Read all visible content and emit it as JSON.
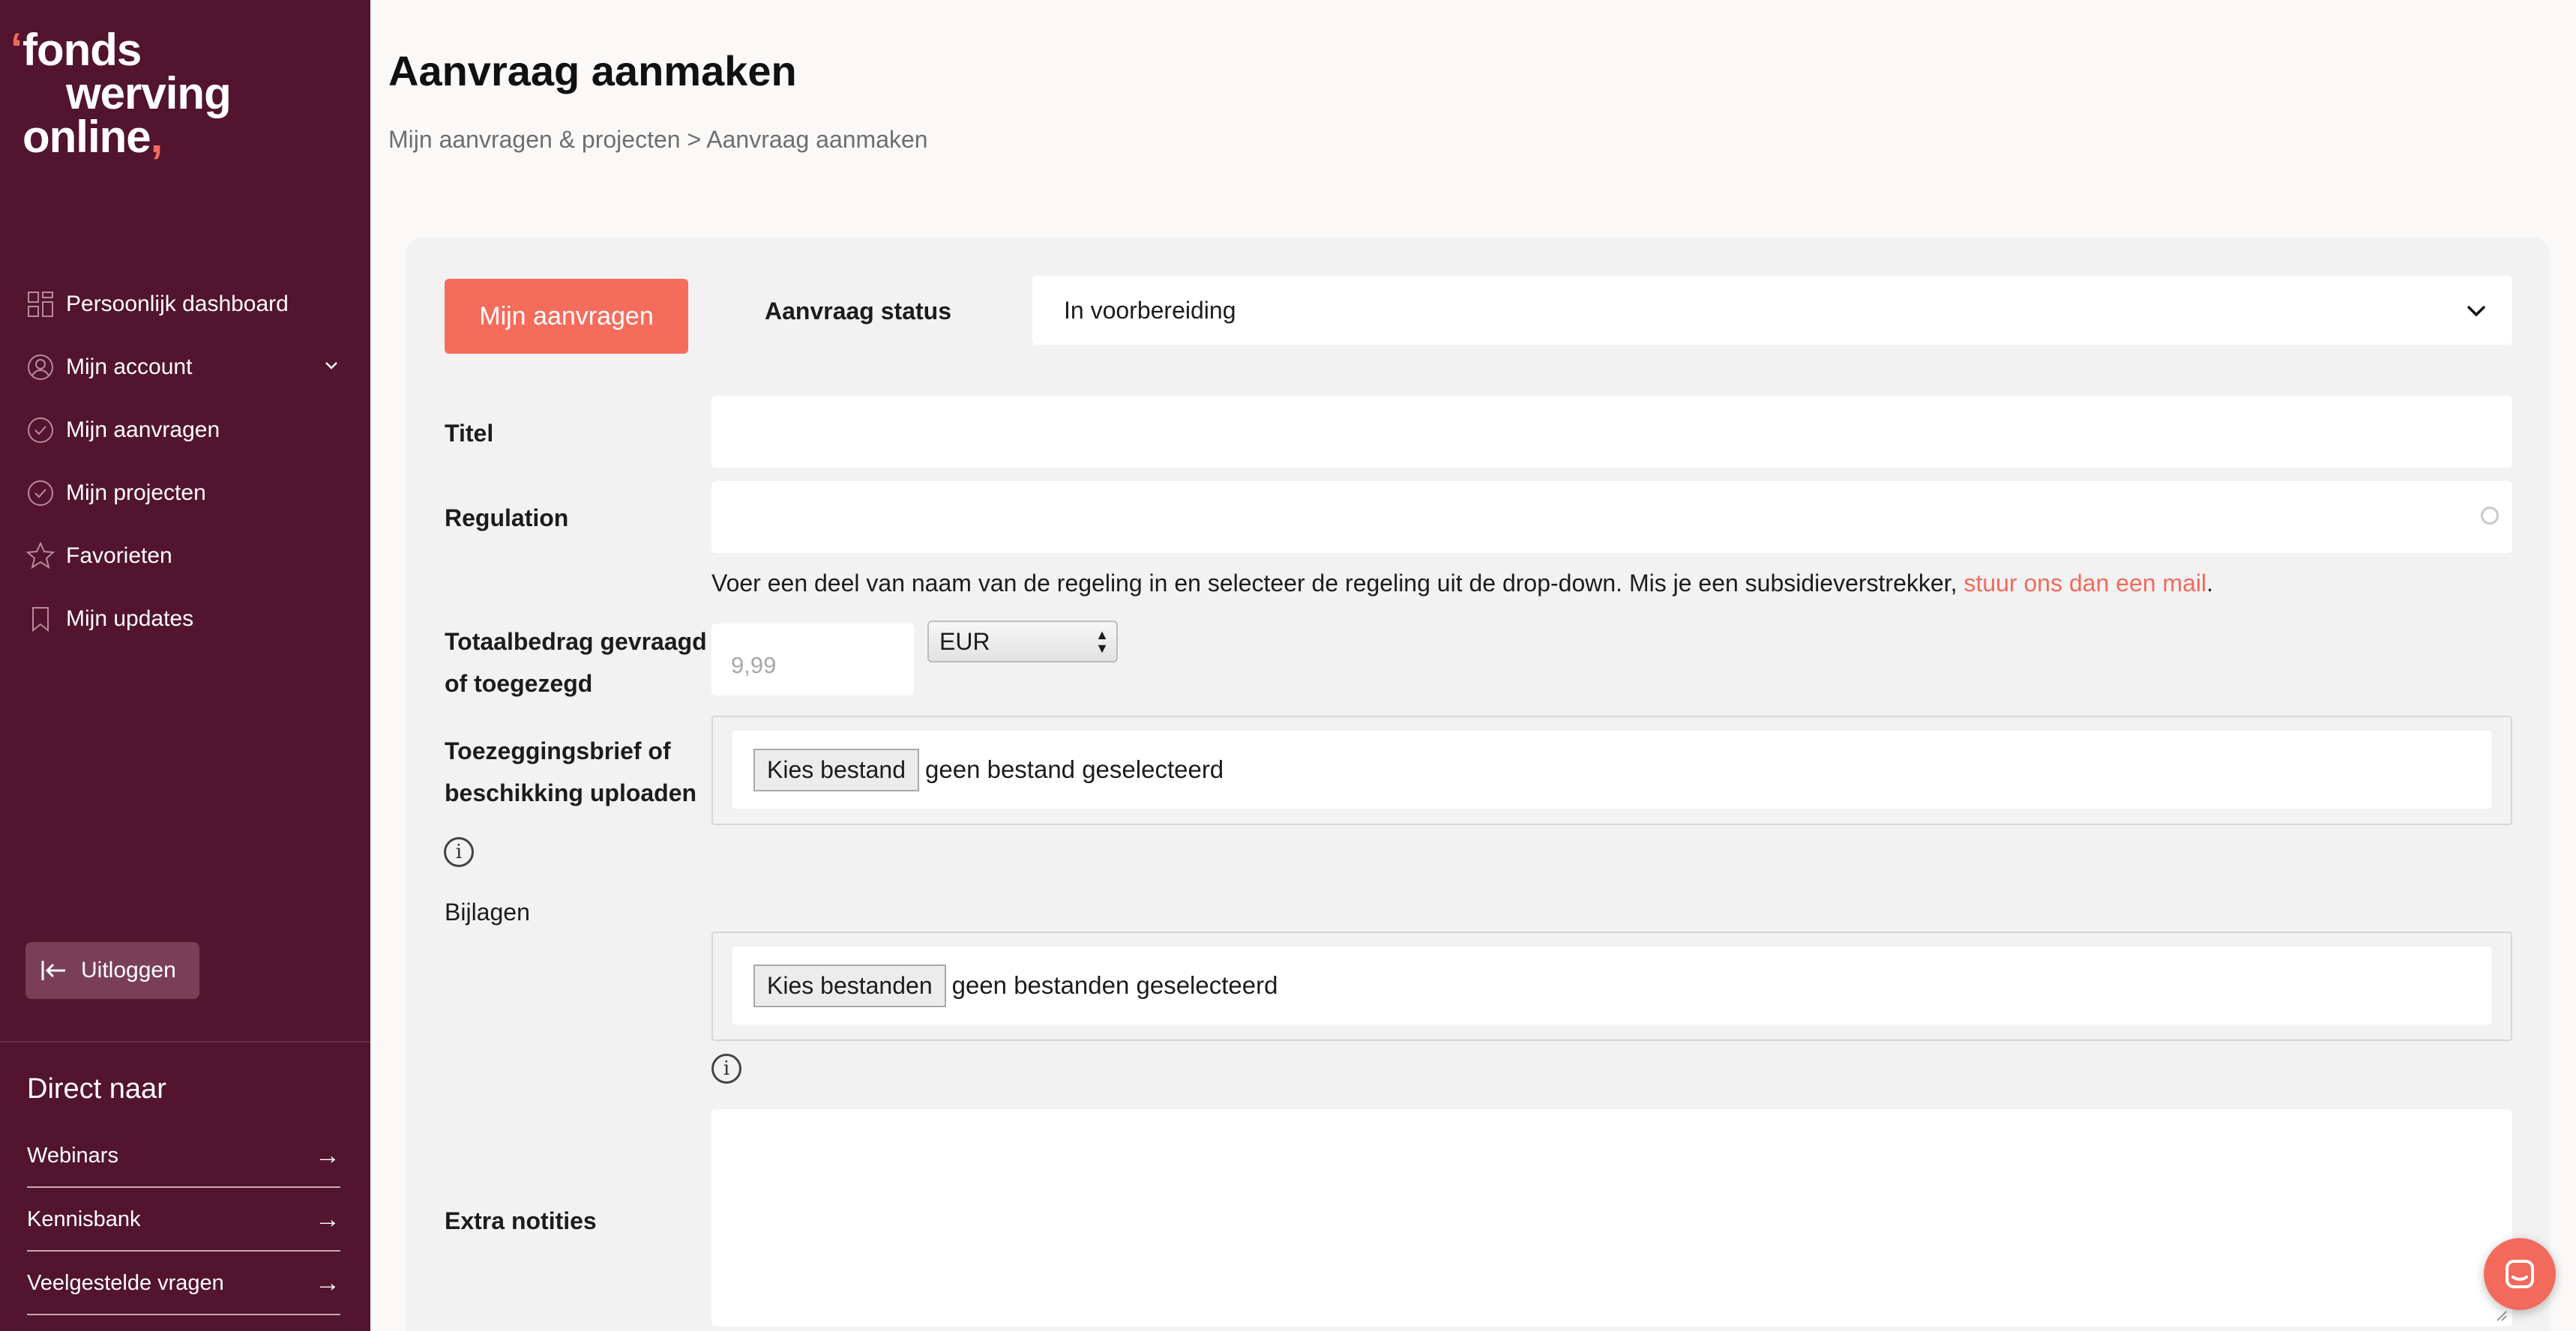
{
  "brand": {
    "logo_lines": [
      "fonds",
      "werving",
      "online"
    ],
    "accent": "#f26a5c",
    "sidebar_bg": "#52142f"
  },
  "sidebar": {
    "nav": [
      {
        "label": "Persoonlijk dashboard",
        "icon": "dashboard-icon"
      },
      {
        "label": "Mijn account",
        "icon": "user-icon"
      },
      {
        "label": "Mijn aanvragen",
        "icon": "check-circle-icon"
      },
      {
        "label": "Mijn projecten",
        "icon": "check-circle-icon"
      },
      {
        "label": "Favorieten",
        "icon": "star-icon"
      },
      {
        "label": "Mijn updates",
        "icon": "bookmark-icon"
      }
    ],
    "logout_label": "Uitloggen",
    "direct_title": "Direct naar",
    "direct_links": [
      {
        "label": "Webinars"
      },
      {
        "label": "Kennisbank"
      },
      {
        "label": "Veelgestelde vragen"
      }
    ]
  },
  "header": {
    "title": "Aanvraag aanmaken",
    "breadcrumb": [
      "Mijn aanvragen & projecten",
      "Aanvraag aanmaken"
    ],
    "breadcrumb_sep": ">"
  },
  "form": {
    "my_requests_button": "Mijn aanvragen",
    "status_label": "Aanvraag status",
    "status_value": "In voorbereiding",
    "title_label": "Titel",
    "regulation_label": "Regulation",
    "regulation_hint": "Voer een deel van naam van de regeling in en selecteer de regeling uit de drop-down. Mis je een subsidieverstrekker, ",
    "regulation_hint_link": "stuur ons dan een mail",
    "regulation_hint_end": ".",
    "amount_label_1": "Totaalbedrag gevraagd",
    "amount_label_2": "of toegezegd",
    "amount_placeholder": "9,99",
    "currency": "EUR",
    "letter_label_1": "Toezeggingsbrief of",
    "letter_label_2": "beschikking uploaden",
    "letter_button": "Kies bestand",
    "letter_status": "geen bestand geselecteerd",
    "attachments_label": "Bijlagen",
    "attachments_button": "Kies bestanden",
    "attachments_status": "geen bestanden geselecteerd",
    "notes_label": "Extra notities"
  }
}
